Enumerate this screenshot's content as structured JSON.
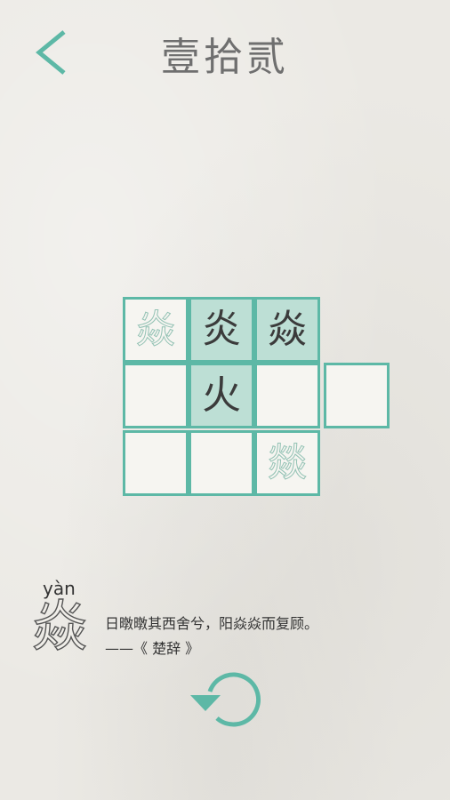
{
  "header": {
    "title": "壹拾贰"
  },
  "colors": {
    "accent": "#5db8a6",
    "given_fill": "#bddfd5",
    "empty_fill": "#f6f5f1",
    "title_text": "#6f6f6f"
  },
  "icons": {
    "back": "chevron-left-icon",
    "reset": "refresh-icon"
  },
  "board": {
    "cells": [
      {
        "id": "r0c0",
        "char": "焱",
        "style": "hint",
        "given": false
      },
      {
        "id": "r0c1",
        "char": "炎",
        "style": "solid",
        "given": true
      },
      {
        "id": "r0c2",
        "char": "焱",
        "style": "solid",
        "given": true
      },
      {
        "id": "r1c0",
        "char": "",
        "style": "empty",
        "given": false
      },
      {
        "id": "r1c1",
        "char": "火",
        "style": "solid",
        "given": true
      },
      {
        "id": "r1c2",
        "char": "",
        "style": "empty",
        "given": false
      },
      {
        "id": "r1c3",
        "char": "",
        "style": "empty",
        "given": false
      },
      {
        "id": "r2c0",
        "char": "",
        "style": "empty",
        "given": false
      },
      {
        "id": "r2c1",
        "char": "",
        "style": "empty",
        "given": false
      },
      {
        "id": "r2c2",
        "char": "燚",
        "style": "hint",
        "given": false
      }
    ]
  },
  "info": {
    "pinyin": "yàn",
    "character": "焱",
    "quote": "日暾暾其西舍兮，阳焱焱而复顾。",
    "source": "——《 楚辞 》"
  }
}
